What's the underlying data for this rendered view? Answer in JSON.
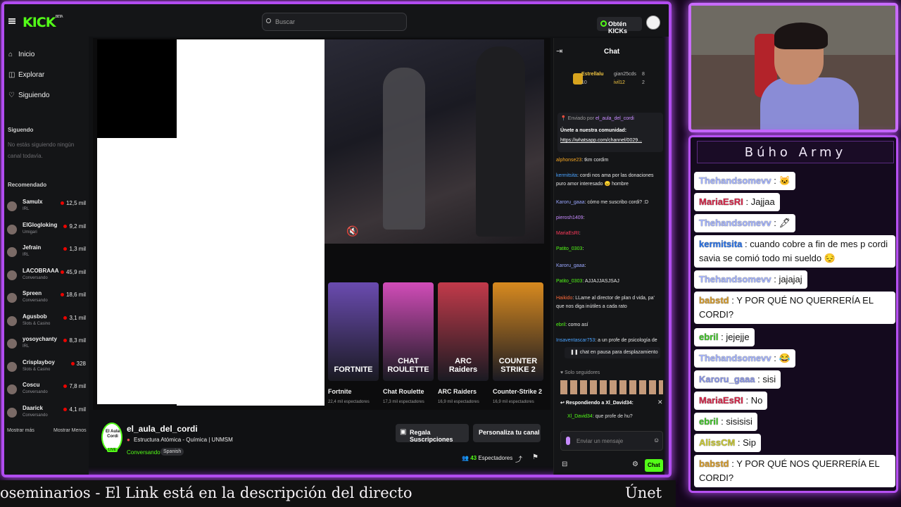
{
  "kick": {
    "logo": "KICK",
    "logo_badge": "BETA",
    "search_placeholder": "Buscar",
    "kicks_button": "Obtén KICKs",
    "nav": [
      {
        "label": "Inicio",
        "icon": "home-icon"
      },
      {
        "label": "Explorar",
        "icon": "compass-icon"
      },
      {
        "label": "Siguiendo",
        "icon": "heart-icon"
      }
    ],
    "following_title": "Siguendo",
    "following_empty": "No estás siguiendo ningún canal todavía.",
    "recommended_title": "Recomendado",
    "recommended": [
      {
        "name": "Samulx",
        "category": "IRL",
        "viewers": "12,5 mil"
      },
      {
        "name": "ElGlogloking",
        "category": "Umigari",
        "viewers": "9,2 mil"
      },
      {
        "name": "Jefrain",
        "category": "IRL",
        "viewers": "1,3 mil"
      },
      {
        "name": "LACOBRAAA",
        "category": "Conversando",
        "viewers": "45,9 mil"
      },
      {
        "name": "Spreen",
        "category": "Conversando",
        "viewers": "18,6 mil"
      },
      {
        "name": "Agusbob",
        "category": "Slots & Casino",
        "viewers": "3,1 mil"
      },
      {
        "name": "yosoychanty",
        "category": "IRL",
        "viewers": "8,3 mil"
      },
      {
        "name": "Crisplayboy",
        "category": "Slots & Casino",
        "viewers": "328"
      },
      {
        "name": "Coscu",
        "category": "Conversando",
        "viewers": "7,8 mil"
      },
      {
        "name": "Daarick",
        "category": "Conversando",
        "viewers": "4,1 mil"
      }
    ],
    "show_more": "Mostrar más",
    "show_less": "Mostrar Menos",
    "categories": [
      {
        "name": "Fortnite",
        "viewers": "22,4 mil espectadores",
        "color": "#6a4bb0",
        "caption": "FORTNITE"
      },
      {
        "name": "Chat Roulette",
        "viewers": "17,3 mil espectadores",
        "color": "#d14cb8",
        "caption": "CHAT ROULETTE"
      },
      {
        "name": "ARC Raiders",
        "viewers": "16,9 mil espectadores",
        "color": "#c23a4a",
        "caption": "ARC Raiders"
      },
      {
        "name": "Counter-Strike 2",
        "viewers": "16,9 mil espectadores",
        "color": "#d88a1f",
        "caption": "COUNTER STRIKE 2"
      }
    ],
    "channel": {
      "logo_text": "El Aula Cordi",
      "live": "LIVE",
      "name": "el_aula_del_cordi",
      "title": "Estructura Atómica - Química | UNMSM",
      "category": "Conversando",
      "language": "Spanish",
      "gift_button": "Regala Suscripciones",
      "customize_button": "Personaliza tu canal",
      "viewers_count": "43",
      "viewers_label": "Espectadores"
    },
    "chat": {
      "title": "Chat",
      "leaderboard": [
        {
          "name": "Estrellalu",
          "value": "10"
        },
        {
          "name": "gian25cds",
          "value": "8"
        },
        {
          "name": "ivil12",
          "value": "2"
        }
      ],
      "pinned_by": "Enviado por",
      "pinned_user": "el_aula_del_cordi",
      "pinned_text": "Únete a nuestra comunidad:",
      "pinned_link": "https://whatsapp.com/channel/0029...",
      "messages": [
        {
          "user": "alphonse23",
          "text": "tkm cordim",
          "color": "#f5a623"
        },
        {
          "user": "kermitsita",
          "text": "cordi nos ama por las donaciones puro amor interesado 😠 hombre",
          "color": "#4aa3ff"
        },
        {
          "user": "Karoru_gaaa",
          "text": "cómo me suscribo cordi? :D",
          "color": "#9aa7ff"
        },
        {
          "user": "pierosh1409",
          "text": "",
          "color": "#c78bff"
        },
        {
          "user": "MariaEsRI",
          "text": "",
          "color": "#ff3b5c"
        },
        {
          "user": "Patito_0303",
          "text": "",
          "color": "#53fc18"
        },
        {
          "user": "Karoru_gaaa",
          "text": "",
          "color": "#9aa7ff"
        },
        {
          "user": "Patito_0303",
          "text": "AJJAJJASJSAJ",
          "color": "#53fc18"
        },
        {
          "user": "Haikido",
          "text": "LLame al director de plan d vida, pa' que nos diga inútiles a cada rato",
          "color": "#ff6b3b"
        },
        {
          "user": "ebril",
          "text": "como así",
          "color": "#53fc18"
        },
        {
          "user": "Insaventascar753",
          "text": "a un profe de psicología de",
          "color": "#4aa3ff"
        }
      ],
      "pause_text": "chat en pausa para desplazamiento",
      "followers_only": "Solo seguidores",
      "reply_to": "Respondiendo a Xl_David34:",
      "reply_user": "Xl_David34",
      "reply_text": "que profe de hu?",
      "input_placeholder": "Enviar un mensaje",
      "send_button": "Chat"
    }
  },
  "ticker": {
    "text": "oseminarios   -   El Link está en la descripción del directo",
    "tail": "Únet"
  },
  "army": {
    "title": "Búho Army",
    "messages": [
      {
        "user": "Thehandsomevv",
        "text": "🐱",
        "color": "#a4b4ff"
      },
      {
        "user": "MariaEsRI",
        "text": "Jajjaa",
        "color": "#d4284a"
      },
      {
        "user": "Thehandsomevv",
        "text": "🖋",
        "color": "#a4b4ff"
      },
      {
        "user": "kermitsita",
        "text": "cuando cobre a fin de mes p cordi savia se comió todo mi sueldo 😔",
        "color": "#2a72e6"
      },
      {
        "user": "Thehandsomevv",
        "text": "jajajaj",
        "color": "#a4b4ff"
      },
      {
        "user": "babstd",
        "text": "Y POR QUÉ NO QUERRERÍA EL CORDI?",
        "color": "#d49a2a"
      },
      {
        "user": "ebril",
        "text": "jejejje",
        "color": "#41c22a"
      },
      {
        "user": "Thehandsomevv",
        "text": "😂",
        "color": "#a4b4ff"
      },
      {
        "user": "Karoru_gaaa",
        "text": "sisi",
        "color": "#8a96e8"
      },
      {
        "user": "MariaEsRI",
        "text": "No",
        "color": "#d4284a"
      },
      {
        "user": "ebril",
        "text": "sisisisi",
        "color": "#41c22a"
      },
      {
        "user": "AlissCM",
        "text": "Sip",
        "color": "#c8c832"
      },
      {
        "user": "babstd",
        "text": "Y POR QUÉ NOS QUERRERÍA EL CORDI?",
        "color": "#d49a2a"
      }
    ]
  },
  "colors": {
    "accent": "#53fc18",
    "frame": "#b14cf0",
    "live": "#eb0400"
  }
}
